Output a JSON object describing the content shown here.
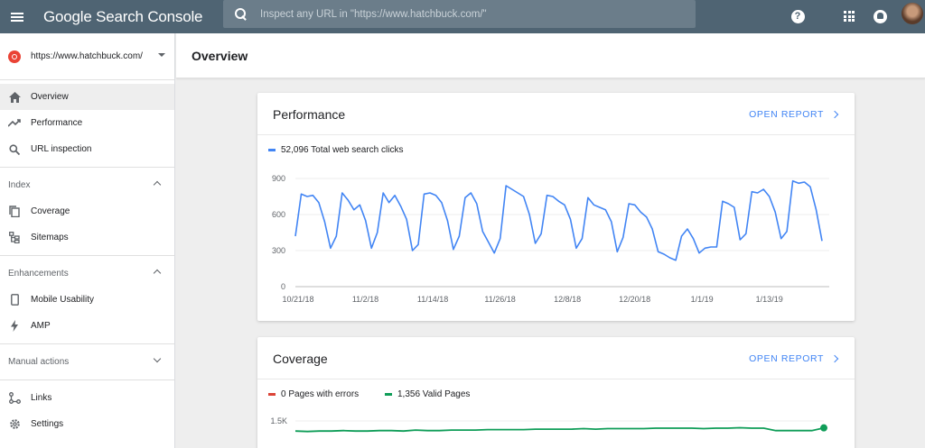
{
  "header": {
    "app_title": "Google Search Console",
    "search_placeholder": "Inspect any URL in \"https://www.hatchbuck.com/\"",
    "help_symbol": "?"
  },
  "sidebar": {
    "property": "https://www.hatchbuck.com/",
    "items": [
      {
        "label": "Overview",
        "icon": "home-icon",
        "active": true
      },
      {
        "label": "Performance",
        "icon": "trending-up-icon"
      },
      {
        "label": "URL inspection",
        "icon": "search-icon"
      }
    ],
    "index_section": {
      "label": "Index",
      "items": [
        {
          "label": "Coverage",
          "icon": "copy-icon"
        },
        {
          "label": "Sitemaps",
          "icon": "sitemap-icon"
        }
      ]
    },
    "enhancements_section": {
      "label": "Enhancements",
      "items": [
        {
          "label": "Mobile Usability",
          "icon": "phone-icon"
        },
        {
          "label": "AMP",
          "icon": "bolt-icon"
        }
      ]
    },
    "manual_actions": {
      "label": "Manual actions"
    },
    "bottom_items": [
      {
        "label": "Links",
        "icon": "links-icon"
      },
      {
        "label": "Settings",
        "icon": "gear-icon"
      }
    ]
  },
  "main": {
    "page_title": "Overview",
    "performance": {
      "title": "Performance",
      "open_report": "OPEN REPORT",
      "legend": "52,096 Total web search clicks"
    },
    "coverage": {
      "title": "Coverage",
      "open_report": "OPEN REPORT",
      "legend_errors": "0 Pages with errors",
      "legend_valid": "1,356 Valid Pages"
    }
  },
  "colors": {
    "topbar": "#4f6473",
    "clicks_line": "#4285f4",
    "errors": "#db4437",
    "valid": "#0f9d58"
  },
  "chart_data": [
    {
      "type": "line",
      "ylim": [
        0,
        900
      ],
      "yticks": [
        "900",
        "600",
        "300",
        "0"
      ],
      "xticks": [
        "10/21/18",
        "11/2/18",
        "11/14/18",
        "11/26/18",
        "12/8/18",
        "12/20/18",
        "1/1/19",
        "1/13/19"
      ],
      "series": [
        {
          "name": "52,096 Total web search clicks",
          "values": [
            420,
            770,
            750,
            760,
            700,
            540,
            320,
            420,
            780,
            720,
            640,
            680,
            550,
            320,
            450,
            780,
            700,
            760,
            670,
            560,
            300,
            350,
            770,
            780,
            760,
            700,
            550,
            310,
            420,
            740,
            780,
            690,
            460,
            370,
            280,
            400,
            840,
            810,
            780,
            750,
            600,
            360,
            440,
            760,
            750,
            710,
            680,
            560,
            320,
            400,
            740,
            680,
            660,
            640,
            540,
            290,
            410,
            690,
            680,
            620,
            580,
            480,
            290,
            270,
            240,
            220,
            420,
            480,
            400,
            280,
            320,
            330,
            330,
            710,
            690,
            660,
            390,
            440,
            790,
            780,
            810,
            750,
            620,
            400,
            460,
            880,
            860,
            870,
            830,
            640,
            380
          ]
        }
      ]
    },
    {
      "type": "line",
      "yticks": [
        "1.5K"
      ],
      "ylim": [
        0,
        1500
      ],
      "series": [
        {
          "name": "1,356 Valid Pages",
          "values": [
            1290,
            1280,
            1290,
            1290,
            1300,
            1290,
            1290,
            1300,
            1300,
            1290,
            1310,
            1300,
            1300,
            1310,
            1310,
            1310,
            1320,
            1320,
            1320,
            1320,
            1330,
            1330,
            1330,
            1330,
            1340,
            1330,
            1340,
            1340,
            1340,
            1340,
            1350,
            1350,
            1350,
            1350,
            1340,
            1350,
            1350,
            1360,
            1350,
            1350,
            1300,
            1300,
            1300,
            1300,
            1356
          ]
        },
        {
          "name": "0 Pages with errors",
          "values": []
        }
      ]
    }
  ]
}
